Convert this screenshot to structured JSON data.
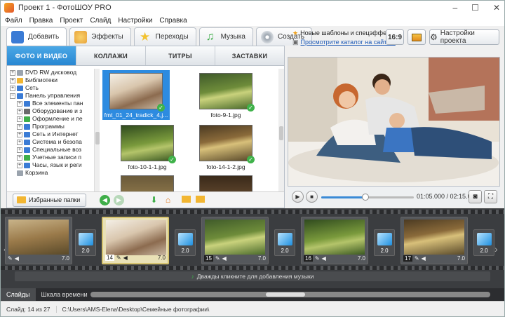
{
  "window": {
    "title": "Проект 1 - ФотоШОУ PRO",
    "controls": {
      "minimize": "–",
      "maximize": "☐",
      "close": "✕"
    }
  },
  "menu": [
    "Файл",
    "Правка",
    "Проект",
    "Слайд",
    "Настройки",
    "Справка"
  ],
  "main_tabs": [
    {
      "label": "Добавить",
      "icon": "add-photo-icon",
      "color": "#3a7bd5",
      "active": true
    },
    {
      "label": "Эффекты",
      "icon": "effects-icon",
      "color": "#e8a33b",
      "active": false
    },
    {
      "label": "Переходы",
      "icon": "star-icon",
      "color": "#f2c230",
      "active": false
    },
    {
      "label": "Музыка",
      "icon": "music-icon",
      "color": "#3fae49",
      "active": false
    },
    {
      "label": "Создать",
      "icon": "disc-icon",
      "color": "#9aa3ad",
      "active": false
    }
  ],
  "news": {
    "line1": "Новые шаблоны и спецэффекты",
    "line2": "Просмотрите каталог на сайте..."
  },
  "toolbar_right": {
    "aspect": "16:9",
    "settings": "Настройки проекта"
  },
  "sub_tabs": [
    {
      "label": "ФОТО И ВИДЕО",
      "active": true
    },
    {
      "label": "КОЛЛАЖИ",
      "active": false
    },
    {
      "label": "ТИТРЫ",
      "active": false
    },
    {
      "label": "ЗАСТАВКИ",
      "active": false
    }
  ],
  "tree": [
    {
      "label": "DVD RW дисковод",
      "toggle": "+",
      "indent": 0,
      "color": "#9aa3ad"
    },
    {
      "label": "Библиотеки",
      "toggle": "+",
      "indent": 0,
      "color": "#f2b632"
    },
    {
      "label": "Сеть",
      "toggle": "+",
      "indent": 0,
      "color": "#3a7bd5"
    },
    {
      "label": "Панель управления",
      "toggle": "−",
      "indent": 0,
      "color": "#3a7bd5"
    },
    {
      "label": "Все элементы пан",
      "toggle": "+",
      "indent": 1,
      "color": "#3a7bd5"
    },
    {
      "label": "Оборудование и з",
      "toggle": "+",
      "indent": 1,
      "color": "#6a6a6a"
    },
    {
      "label": "Оформление и пе",
      "toggle": "+",
      "indent": 1,
      "color": "#3fae49"
    },
    {
      "label": "Программы",
      "toggle": "+",
      "indent": 1,
      "color": "#3a7bd5"
    },
    {
      "label": "Сеть и Интернет",
      "toggle": "+",
      "indent": 1,
      "color": "#3a7bd5"
    },
    {
      "label": "Система и безопа",
      "toggle": "+",
      "indent": 1,
      "color": "#3a7bd5"
    },
    {
      "label": "Специальные воз",
      "toggle": "+",
      "indent": 1,
      "color": "#3a7bd5"
    },
    {
      "label": "Учетные записи п",
      "toggle": "+",
      "indent": 1,
      "color": "#3fae49"
    },
    {
      "label": "Часы, язык и реги",
      "toggle": "+",
      "indent": 1,
      "color": "#3a7bd5"
    },
    {
      "label": "Корзина",
      "toggle": "",
      "indent": 0,
      "color": "#9aa3ad"
    }
  ],
  "thumbs": [
    {
      "name": "fmt_01_24_tradick_4,j...",
      "selected": true,
      "check": "✓"
    },
    {
      "name": "foto-9-1.jpg",
      "selected": false,
      "check": "✓"
    },
    {
      "name": "foto-10-1-1.jpg",
      "selected": false,
      "check": "✓"
    },
    {
      "name": "foto-14-1-2.jpg",
      "selected": false,
      "check": "✓"
    }
  ],
  "left_bottom": {
    "favorites": "Избранные папки"
  },
  "player": {
    "play": "▶",
    "stop": "■",
    "timecode": "01:05.000 / 02:15.000",
    "progress": 0.48
  },
  "slides": [
    {
      "num": "",
      "duration": "7.0",
      "selected": false
    },
    {
      "num": "14",
      "duration": "7.0",
      "selected": true
    },
    {
      "num": "15",
      "duration": "7.0",
      "selected": false
    },
    {
      "num": "16",
      "duration": "7.0",
      "selected": false
    },
    {
      "num": "17",
      "duration": "7.0",
      "selected": false
    }
  ],
  "transitions": [
    "2.0",
    "2.0",
    "2.0",
    "2.0",
    "2.0"
  ],
  "music_hint": "Дважды кликните для добавления музыки",
  "bottom_tabs": [
    {
      "label": "Слайды",
      "active": true
    },
    {
      "label": "Шкала времени",
      "active": false
    }
  ],
  "status": {
    "slide": "Слайд: 14 из 27",
    "path": "C:\\Users\\AMS-Elena\\Desktop\\Семейные фотографии\\"
  }
}
